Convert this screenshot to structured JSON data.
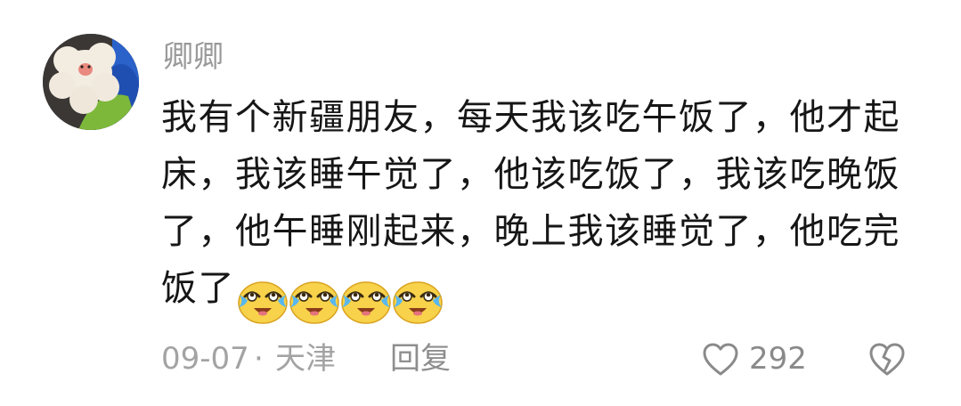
{
  "comment": {
    "username": "卿卿",
    "text": "我有个新疆朋友，每天我该吃午饭了，他才起床，我该睡午觉了，他该吃饭了，我该吃晚饭了，他午睡刚起来，晚上我该睡觉了，他吃完饭了",
    "emojis": [
      "crying-laughing-emoji",
      "crying-laughing-emoji",
      "crying-laughing-emoji",
      "crying-laughing-emoji"
    ],
    "date": "09-07",
    "separator": "·",
    "location": "天津",
    "reply_label": "回复",
    "like_count": "292",
    "icons": {
      "like": "heart-outline-icon",
      "dislike": "broken-heart-icon"
    },
    "colors": {
      "text": "#161616",
      "meta": "#a3a3a3",
      "emoji_face": "#f7d24a"
    }
  }
}
